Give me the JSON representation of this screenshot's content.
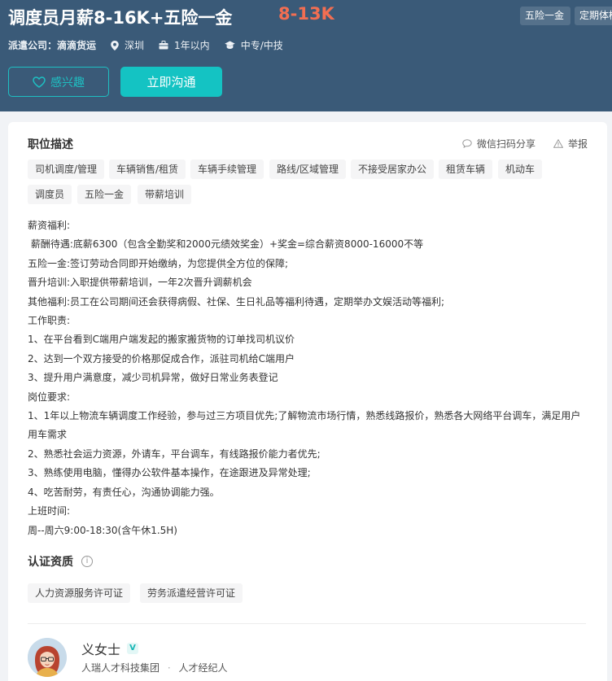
{
  "header": {
    "job_title": "调度员月薪8-16K+五险一金",
    "salary": "8-13K",
    "top_tags": [
      "五险一金",
      "定期体检"
    ],
    "company_label": "派遣公司：",
    "company_name": "滴滴货运",
    "location": "深圳",
    "experience": "1年以内",
    "education": "中专/中技",
    "interest_button": "感兴趣",
    "chat_button": "立即沟通"
  },
  "job_description": {
    "title": "职位描述",
    "share_label": "微信扫码分享",
    "report_label": "举报",
    "tags": [
      "司机调度/管理",
      "车辆销售/租赁",
      "车辆手续管理",
      "路线/区域管理",
      "不接受居家办公",
      "租赁车辆",
      "机动车",
      "调度员",
      "五险一金",
      "带薪培训"
    ],
    "lines": [
      "薪资福利:",
      " 薪酬待遇:底薪6300（包含全勤奖和2000元绩效奖金）+奖金=综合薪资8000-16000不等",
      "五险一金:签订劳动合同即开始缴纳，为您提供全方位的保障;",
      "晋升培训:入职提供带薪培训，一年2次晋升调薪机会",
      "其他福利:员工在公司期间还会获得病假、社保、生日礼品等福利待遇，定期举办文娱活动等福利;",
      "工作职责:",
      "1、在平台看到C端用户端发起的搬家搬货物的订单找司机议价",
      "2、达到一个双方接受的价格那促成合作，派驻司机给C端用户",
      "3、提升用户满意度，减少司机异常，做好日常业务表登记",
      "岗位要求:",
      "1、1年以上物流车辆调度工作经验，参与过三方项目优先;了解物流市场行情，熟悉线路报价，熟悉各大网络平台调车，满足用户用车需求",
      "2、熟悉社会运力资源，外请车，平台调车，有线路报价能力者优先;",
      "3、熟练使用电脑，懂得办公软件基本操作，在途跟进及异常处理;",
      "4、吃苦耐劳，有责任心，沟通协调能力强。",
      "上班时间:",
      "周--周六9:00-18:30(含午休1.5H)"
    ]
  },
  "certification": {
    "title": "认证资质",
    "tags": [
      "人力资源服务许可证",
      "劳务派遣经营许可证"
    ]
  },
  "recruiter": {
    "name": "义女士",
    "verified_badge": "V",
    "company": "人瑞人才科技集团",
    "separator": "·",
    "role": "人才经纪人"
  },
  "colors": {
    "header_bg": "#3a5a78",
    "salary": "#f26e52",
    "accent": "#14c3c3"
  }
}
